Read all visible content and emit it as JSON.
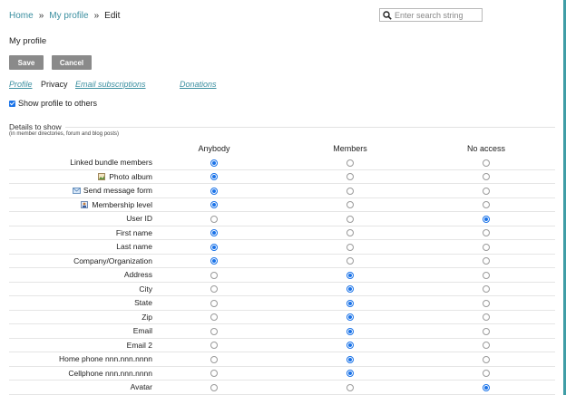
{
  "breadcrumb": {
    "items": [
      "Home",
      "My profile",
      "Edit"
    ],
    "separator": "»"
  },
  "search": {
    "placeholder": "Enter search string",
    "value": ""
  },
  "page_title": "My profile",
  "buttons": {
    "save": "Save",
    "cancel": "Cancel"
  },
  "tabs": [
    {
      "label": "Profile",
      "active": false
    },
    {
      "label": "Privacy",
      "active": true
    },
    {
      "label": "Email subscriptions",
      "active": false
    },
    {
      "label": "Donations",
      "active": false
    }
  ],
  "show_profile": {
    "label": "Show profile to others",
    "checked": true
  },
  "details": {
    "title": "Details to show",
    "subtitle": "(in member directories, forum and blog posts)"
  },
  "columns": [
    "Anybody",
    "Members",
    "No access"
  ],
  "rows": [
    {
      "label": "Linked bundle members",
      "icon": "",
      "selected": 0
    },
    {
      "label": "Photo album",
      "icon": "photo-album-icon",
      "selected": 0
    },
    {
      "label": "Send message form",
      "icon": "envelope-icon",
      "selected": 0
    },
    {
      "label": "Membership level",
      "icon": "membership-level-icon",
      "selected": 0
    },
    {
      "label": "User ID",
      "icon": "",
      "selected": 2
    },
    {
      "label": "First name",
      "icon": "",
      "selected": 0
    },
    {
      "label": "Last name",
      "icon": "",
      "selected": 0
    },
    {
      "label": "Company/Organization",
      "icon": "",
      "selected": 0
    },
    {
      "label": "Address",
      "icon": "",
      "selected": 1
    },
    {
      "label": "City",
      "icon": "",
      "selected": 1
    },
    {
      "label": "State",
      "icon": "",
      "selected": 1
    },
    {
      "label": "Zip",
      "icon": "",
      "selected": 1
    },
    {
      "label": "Email",
      "icon": "",
      "selected": 1
    },
    {
      "label": "Email 2",
      "icon": "",
      "selected": 1
    },
    {
      "label": "Home phone nnn.nnn.nnnn",
      "icon": "",
      "selected": 1
    },
    {
      "label": "Cellphone nnn.nnn.nnnn",
      "icon": "",
      "selected": 1
    },
    {
      "label": "Avatar",
      "icon": "",
      "selected": 2
    }
  ],
  "colors": {
    "link": "#3b8fa0",
    "accent_bar": "#3f9da6",
    "button": "#8a8a8a",
    "radio_checked": "#1a73e8"
  }
}
